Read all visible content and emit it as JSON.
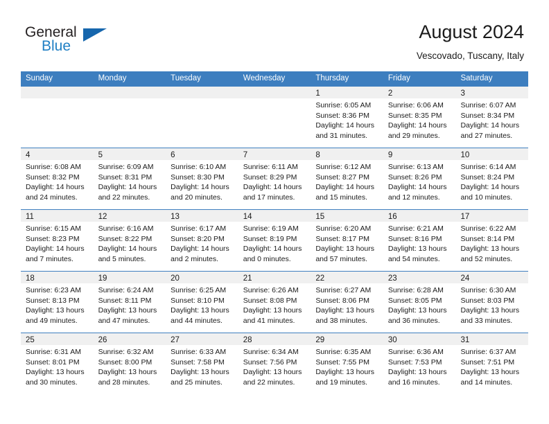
{
  "brand": {
    "name_top": "General",
    "name_bottom": "Blue",
    "flag_color": "#1666ad",
    "blue_text_color": "#1f7fc4"
  },
  "header": {
    "title": "August 2024",
    "subtitle": "Vescovado, Tuscany, Italy"
  },
  "theme": {
    "header_band": "#3d7ebf",
    "daynum_band": "#f0f0f0",
    "row_divider": "#3d7ebf"
  },
  "weekdays": [
    "Sunday",
    "Monday",
    "Tuesday",
    "Wednesday",
    "Thursday",
    "Friday",
    "Saturday"
  ],
  "weeks": [
    [
      {
        "day": "",
        "l1": "",
        "l2": "",
        "l3": "",
        "l4": ""
      },
      {
        "day": "",
        "l1": "",
        "l2": "",
        "l3": "",
        "l4": ""
      },
      {
        "day": "",
        "l1": "",
        "l2": "",
        "l3": "",
        "l4": ""
      },
      {
        "day": "",
        "l1": "",
        "l2": "",
        "l3": "",
        "l4": ""
      },
      {
        "day": "1",
        "l1": "Sunrise: 6:05 AM",
        "l2": "Sunset: 8:36 PM",
        "l3": "Daylight: 14 hours",
        "l4": "and 31 minutes."
      },
      {
        "day": "2",
        "l1": "Sunrise: 6:06 AM",
        "l2": "Sunset: 8:35 PM",
        "l3": "Daylight: 14 hours",
        "l4": "and 29 minutes."
      },
      {
        "day": "3",
        "l1": "Sunrise: 6:07 AM",
        "l2": "Sunset: 8:34 PM",
        "l3": "Daylight: 14 hours",
        "l4": "and 27 minutes."
      }
    ],
    [
      {
        "day": "4",
        "l1": "Sunrise: 6:08 AM",
        "l2": "Sunset: 8:32 PM",
        "l3": "Daylight: 14 hours",
        "l4": "and 24 minutes."
      },
      {
        "day": "5",
        "l1": "Sunrise: 6:09 AM",
        "l2": "Sunset: 8:31 PM",
        "l3": "Daylight: 14 hours",
        "l4": "and 22 minutes."
      },
      {
        "day": "6",
        "l1": "Sunrise: 6:10 AM",
        "l2": "Sunset: 8:30 PM",
        "l3": "Daylight: 14 hours",
        "l4": "and 20 minutes."
      },
      {
        "day": "7",
        "l1": "Sunrise: 6:11 AM",
        "l2": "Sunset: 8:29 PM",
        "l3": "Daylight: 14 hours",
        "l4": "and 17 minutes."
      },
      {
        "day": "8",
        "l1": "Sunrise: 6:12 AM",
        "l2": "Sunset: 8:27 PM",
        "l3": "Daylight: 14 hours",
        "l4": "and 15 minutes."
      },
      {
        "day": "9",
        "l1": "Sunrise: 6:13 AM",
        "l2": "Sunset: 8:26 PM",
        "l3": "Daylight: 14 hours",
        "l4": "and 12 minutes."
      },
      {
        "day": "10",
        "l1": "Sunrise: 6:14 AM",
        "l2": "Sunset: 8:24 PM",
        "l3": "Daylight: 14 hours",
        "l4": "and 10 minutes."
      }
    ],
    [
      {
        "day": "11",
        "l1": "Sunrise: 6:15 AM",
        "l2": "Sunset: 8:23 PM",
        "l3": "Daylight: 14 hours",
        "l4": "and 7 minutes."
      },
      {
        "day": "12",
        "l1": "Sunrise: 6:16 AM",
        "l2": "Sunset: 8:22 PM",
        "l3": "Daylight: 14 hours",
        "l4": "and 5 minutes."
      },
      {
        "day": "13",
        "l1": "Sunrise: 6:17 AM",
        "l2": "Sunset: 8:20 PM",
        "l3": "Daylight: 14 hours",
        "l4": "and 2 minutes."
      },
      {
        "day": "14",
        "l1": "Sunrise: 6:19 AM",
        "l2": "Sunset: 8:19 PM",
        "l3": "Daylight: 14 hours",
        "l4": "and 0 minutes."
      },
      {
        "day": "15",
        "l1": "Sunrise: 6:20 AM",
        "l2": "Sunset: 8:17 PM",
        "l3": "Daylight: 13 hours",
        "l4": "and 57 minutes."
      },
      {
        "day": "16",
        "l1": "Sunrise: 6:21 AM",
        "l2": "Sunset: 8:16 PM",
        "l3": "Daylight: 13 hours",
        "l4": "and 54 minutes."
      },
      {
        "day": "17",
        "l1": "Sunrise: 6:22 AM",
        "l2": "Sunset: 8:14 PM",
        "l3": "Daylight: 13 hours",
        "l4": "and 52 minutes."
      }
    ],
    [
      {
        "day": "18",
        "l1": "Sunrise: 6:23 AM",
        "l2": "Sunset: 8:13 PM",
        "l3": "Daylight: 13 hours",
        "l4": "and 49 minutes."
      },
      {
        "day": "19",
        "l1": "Sunrise: 6:24 AM",
        "l2": "Sunset: 8:11 PM",
        "l3": "Daylight: 13 hours",
        "l4": "and 47 minutes."
      },
      {
        "day": "20",
        "l1": "Sunrise: 6:25 AM",
        "l2": "Sunset: 8:10 PM",
        "l3": "Daylight: 13 hours",
        "l4": "and 44 minutes."
      },
      {
        "day": "21",
        "l1": "Sunrise: 6:26 AM",
        "l2": "Sunset: 8:08 PM",
        "l3": "Daylight: 13 hours",
        "l4": "and 41 minutes."
      },
      {
        "day": "22",
        "l1": "Sunrise: 6:27 AM",
        "l2": "Sunset: 8:06 PM",
        "l3": "Daylight: 13 hours",
        "l4": "and 38 minutes."
      },
      {
        "day": "23",
        "l1": "Sunrise: 6:28 AM",
        "l2": "Sunset: 8:05 PM",
        "l3": "Daylight: 13 hours",
        "l4": "and 36 minutes."
      },
      {
        "day": "24",
        "l1": "Sunrise: 6:30 AM",
        "l2": "Sunset: 8:03 PM",
        "l3": "Daylight: 13 hours",
        "l4": "and 33 minutes."
      }
    ],
    [
      {
        "day": "25",
        "l1": "Sunrise: 6:31 AM",
        "l2": "Sunset: 8:01 PM",
        "l3": "Daylight: 13 hours",
        "l4": "and 30 minutes."
      },
      {
        "day": "26",
        "l1": "Sunrise: 6:32 AM",
        "l2": "Sunset: 8:00 PM",
        "l3": "Daylight: 13 hours",
        "l4": "and 28 minutes."
      },
      {
        "day": "27",
        "l1": "Sunrise: 6:33 AM",
        "l2": "Sunset: 7:58 PM",
        "l3": "Daylight: 13 hours",
        "l4": "and 25 minutes."
      },
      {
        "day": "28",
        "l1": "Sunrise: 6:34 AM",
        "l2": "Sunset: 7:56 PM",
        "l3": "Daylight: 13 hours",
        "l4": "and 22 minutes."
      },
      {
        "day": "29",
        "l1": "Sunrise: 6:35 AM",
        "l2": "Sunset: 7:55 PM",
        "l3": "Daylight: 13 hours",
        "l4": "and 19 minutes."
      },
      {
        "day": "30",
        "l1": "Sunrise: 6:36 AM",
        "l2": "Sunset: 7:53 PM",
        "l3": "Daylight: 13 hours",
        "l4": "and 16 minutes."
      },
      {
        "day": "31",
        "l1": "Sunrise: 6:37 AM",
        "l2": "Sunset: 7:51 PM",
        "l3": "Daylight: 13 hours",
        "l4": "and 14 minutes."
      }
    ]
  ]
}
